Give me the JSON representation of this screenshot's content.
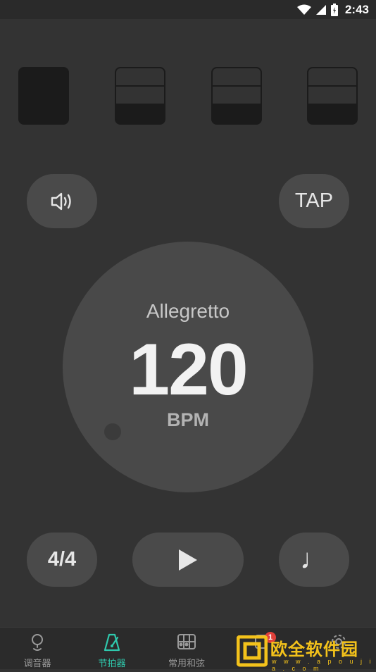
{
  "status_bar": {
    "time": "2:43"
  },
  "beats": [
    {
      "state": "accent"
    },
    {
      "state": "normal"
    },
    {
      "state": "normal"
    },
    {
      "state": "normal"
    }
  ],
  "controls": {
    "sound_icon": "speaker-icon",
    "tap_label": "TAP",
    "time_signature": "4/4",
    "play_icon": "play-icon",
    "note_symbol": "♩"
  },
  "dial": {
    "tempo_name": "Allegretto",
    "bpm": "120",
    "unit": "BPM"
  },
  "nav": {
    "items": [
      {
        "label": "调音器",
        "icon": "tuner-icon"
      },
      {
        "label": "节拍器",
        "icon": "metronome-icon",
        "active": true
      },
      {
        "label": "常用和弦",
        "icon": "chord-icon"
      },
      {
        "label": "",
        "icon": "unknown-icon",
        "badge": "1"
      },
      {
        "label": "",
        "icon": "settings-icon"
      }
    ]
  },
  "watermark": {
    "text": "欧全软件园",
    "url": "w w w . a p o u j i a . c o m"
  },
  "colors": {
    "accent": "#2fc9ad",
    "background": "#333333",
    "button": "#4a4a4a",
    "dial": "#494949"
  }
}
